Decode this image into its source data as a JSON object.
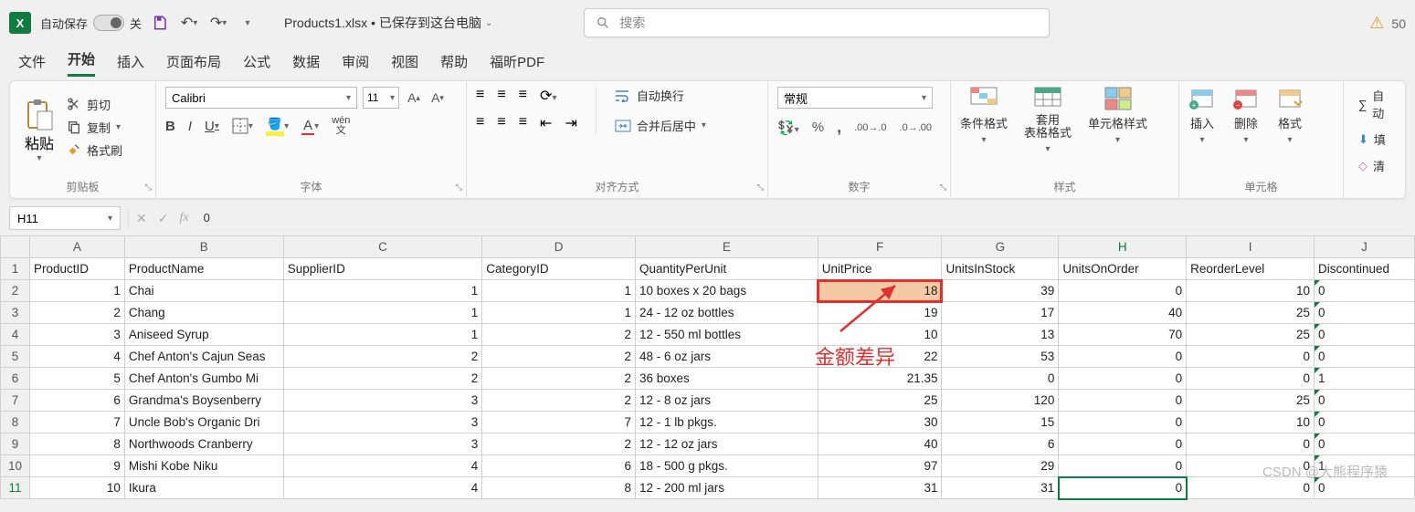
{
  "title_bar": {
    "autosave_label": "自动保存",
    "autosave_state": "关",
    "filename": "Products1.xlsx",
    "saved_status": "已保存到这台电脑",
    "search_placeholder": "搜索",
    "warn_count": "50"
  },
  "tabs": [
    "文件",
    "开始",
    "插入",
    "页面布局",
    "公式",
    "数据",
    "审阅",
    "视图",
    "帮助",
    "福昕PDF"
  ],
  "active_tab_index": 1,
  "ribbon": {
    "clipboard": {
      "label": "剪贴板",
      "paste": "粘贴",
      "cut": "剪切",
      "copy": "复制",
      "painter": "格式刷"
    },
    "font": {
      "label": "字体",
      "name": "Calibri",
      "size": "11",
      "bold": "B",
      "italic": "I",
      "underline": "U",
      "ruby": "wén"
    },
    "alignment": {
      "label": "对齐方式",
      "wrap": "自动换行",
      "merge": "合并后居中"
    },
    "number": {
      "label": "数字",
      "format": "常规",
      "percent": "%",
      "comma": ","
    },
    "styles": {
      "label": "样式",
      "cond": "条件格式",
      "table": "套用\n表格格式",
      "cell": "单元格样式"
    },
    "cells": {
      "label": "单元格",
      "insert": "插入",
      "delete": "删除",
      "format": "格式"
    },
    "editing": {
      "sum": "自动",
      "fill": "填",
      "clear": "清"
    }
  },
  "name_box": "H11",
  "formula_value": "0",
  "columns": [
    "A",
    "B",
    "C",
    "D",
    "E",
    "F",
    "G",
    "H",
    "I",
    "J"
  ],
  "headers_row": [
    "ProductID",
    "ProductName",
    "SupplierID",
    "CategoryID",
    "QuantityPerUnit",
    "UnitPrice",
    "UnitsInStock",
    "UnitsOnOrder",
    "ReorderLevel",
    "Discontinued"
  ],
  "rows": [
    {
      "n": 2,
      "d": [
        "1",
        "Chai",
        "1",
        "1",
        "10 boxes x 20 bags",
        "18",
        "39",
        "0",
        "10",
        "0"
      ]
    },
    {
      "n": 3,
      "d": [
        "2",
        "Chang",
        "1",
        "1",
        "24 - 12 oz bottles",
        "19",
        "17",
        "40",
        "25",
        "0"
      ]
    },
    {
      "n": 4,
      "d": [
        "3",
        "Aniseed Syrup",
        "1",
        "2",
        "12 - 550 ml bottles",
        "10",
        "13",
        "70",
        "25",
        "0"
      ]
    },
    {
      "n": 5,
      "d": [
        "4",
        "Chef Anton's Cajun Seas",
        "2",
        "2",
        "48 - 6 oz jars",
        "22",
        "53",
        "0",
        "0",
        "0"
      ]
    },
    {
      "n": 6,
      "d": [
        "5",
        "Chef Anton's Gumbo Mi",
        "2",
        "2",
        "36 boxes",
        "21.35",
        "0",
        "0",
        "0",
        "1"
      ]
    },
    {
      "n": 7,
      "d": [
        "6",
        "Grandma's Boysenberry",
        "3",
        "2",
        "12 - 8 oz jars",
        "25",
        "120",
        "0",
        "25",
        "0"
      ]
    },
    {
      "n": 8,
      "d": [
        "7",
        "Uncle Bob's Organic Dri",
        "3",
        "7",
        "12 - 1 lb pkgs.",
        "30",
        "15",
        "0",
        "10",
        "0"
      ]
    },
    {
      "n": 9,
      "d": [
        "8",
        "Northwoods Cranberry",
        "3",
        "2",
        "12 - 12 oz jars",
        "40",
        "6",
        "0",
        "0",
        "0"
      ]
    },
    {
      "n": 10,
      "d": [
        "9",
        "Mishi Kobe Niku",
        "4",
        "6",
        "18 - 500 g pkgs.",
        "97",
        "29",
        "0",
        "0",
        "1"
      ]
    },
    {
      "n": 11,
      "d": [
        "10",
        "Ikura",
        "4",
        "8",
        "12 - 200 ml jars",
        "31",
        "31",
        "0",
        "0",
        "0"
      ]
    }
  ],
  "annotation": "金额差异",
  "watermark": "CSDN @大熊程序猿",
  "chart_data": {
    "type": "table",
    "title": "Products1.xlsx",
    "columns": [
      "ProductID",
      "ProductName",
      "SupplierID",
      "CategoryID",
      "QuantityPerUnit",
      "UnitPrice",
      "UnitsInStock",
      "UnitsOnOrder",
      "ReorderLevel",
      "Discontinued"
    ],
    "data": [
      [
        1,
        "Chai",
        1,
        1,
        "10 boxes x 20 bags",
        18,
        39,
        0,
        10,
        0
      ],
      [
        2,
        "Chang",
        1,
        1,
        "24 - 12 oz bottles",
        19,
        17,
        40,
        25,
        0
      ],
      [
        3,
        "Aniseed Syrup",
        1,
        2,
        "12 - 550 ml bottles",
        10,
        13,
        70,
        25,
        0
      ],
      [
        4,
        "Chef Anton's Cajun Seasoning",
        2,
        2,
        "48 - 6 oz jars",
        22,
        53,
        0,
        0,
        0
      ],
      [
        5,
        "Chef Anton's Gumbo Mix",
        2,
        2,
        "36 boxes",
        21.35,
        0,
        0,
        0,
        1
      ],
      [
        6,
        "Grandma's Boysenberry",
        3,
        2,
        "12 - 8 oz jars",
        25,
        120,
        0,
        25,
        0
      ],
      [
        7,
        "Uncle Bob's Organic Dried",
        3,
        7,
        "12 - 1 lb pkgs.",
        30,
        15,
        0,
        10,
        0
      ],
      [
        8,
        "Northwoods Cranberry",
        3,
        2,
        "12 - 12 oz jars",
        40,
        6,
        0,
        0,
        0
      ],
      [
        9,
        "Mishi Kobe Niku",
        4,
        6,
        "18 - 500 g pkgs.",
        97,
        29,
        0,
        0,
        1
      ],
      [
        10,
        "Ikura",
        4,
        8,
        "12 - 200 ml jars",
        31,
        31,
        0,
        0,
        0
      ]
    ]
  }
}
